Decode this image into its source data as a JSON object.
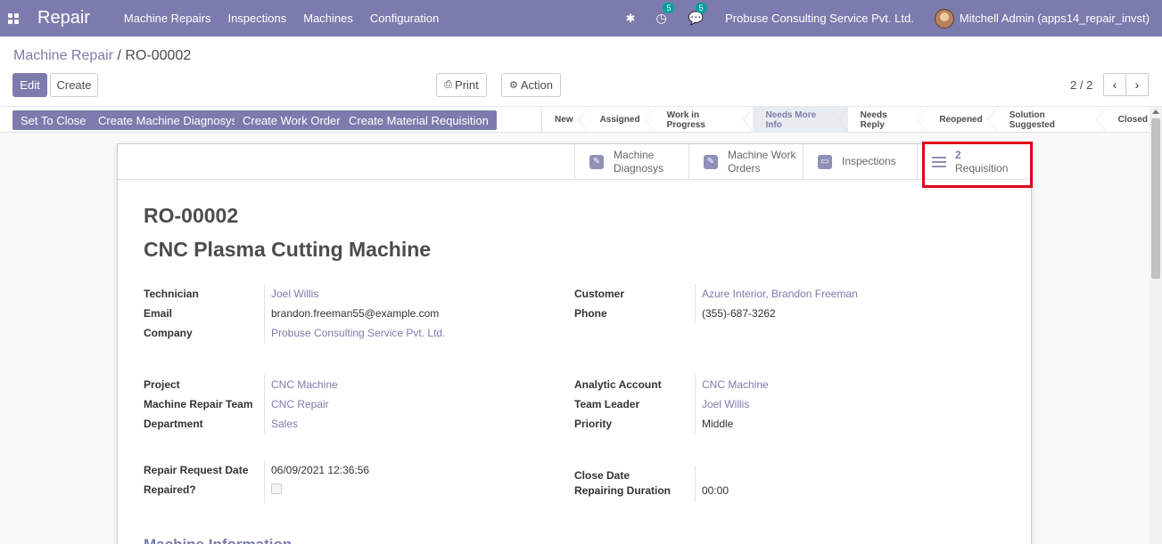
{
  "navbar": {
    "app_name": "Repair",
    "menu": [
      "Machine Repairs",
      "Inspections",
      "Machines",
      "Configuration"
    ],
    "activity_badge": "5",
    "messages_badge": "5",
    "company": "Probuse Consulting Service Pvt. Ltd.",
    "user": "Mitchell Admin (apps14_repair_invst)"
  },
  "breadcrumb": {
    "parent": "Machine Repair",
    "separator": "/",
    "current": "RO-00002"
  },
  "actions": {
    "edit": "Edit",
    "create": "Create",
    "print": "Print",
    "action": "Action"
  },
  "pager": {
    "value": "2 / 2"
  },
  "statusbar": {
    "buttons": [
      "Set To Close",
      "Create Machine Diagnosys",
      "Create Work Order",
      "Create Material Requisition"
    ],
    "stages": [
      "New",
      "Assigned",
      "Work in Progress",
      "Needs More Info",
      "Needs Reply",
      "Reopened",
      "Solution Suggested",
      "Closed"
    ],
    "active_stage": "Needs More Info"
  },
  "smart_buttons": {
    "diagnosys_line1": "Machine",
    "diagnosys_line2": "Diagnosys",
    "work_orders_line1": "Machine Work",
    "work_orders_line2": "Orders",
    "inspections": "Inspections",
    "requisition_count": "2",
    "requisition_label": "Requisition"
  },
  "record": {
    "reference": "RO-00002",
    "name": "CNC Plasma Cutting Machine",
    "technician_label": "Technician",
    "technician": "Joel Willis",
    "email_label": "Email",
    "email": "brandon.freeman55@example.com",
    "company_label": "Company",
    "company": "Probuse Consulting Service Pvt. Ltd.",
    "customer_label": "Customer",
    "customer": "Azure Interior, Brandon Freeman",
    "phone_label": "Phone",
    "phone": "(355)-687-3262",
    "project_label": "Project",
    "project": "CNC Machine",
    "team_label": "Machine Repair Team",
    "team": "CNC Repair",
    "department_label": "Department",
    "department": "Sales",
    "analytic_label": "Analytic Account",
    "analytic": "CNC Machine",
    "leader_label": "Team Leader",
    "leader": "Joel Willis",
    "priority_label": "Priority",
    "priority": "Middle",
    "request_date_label": "Repair Request Date",
    "request_date": "06/09/2021 12:36:56",
    "repaired_label": "Repaired?",
    "close_date_label": "Close Date",
    "duration_label": "Repairing Duration",
    "duration": "00:00",
    "section_title": "Machine Information"
  },
  "colors": {
    "brand": "#7c7bad",
    "highlight": "#e0001b"
  }
}
